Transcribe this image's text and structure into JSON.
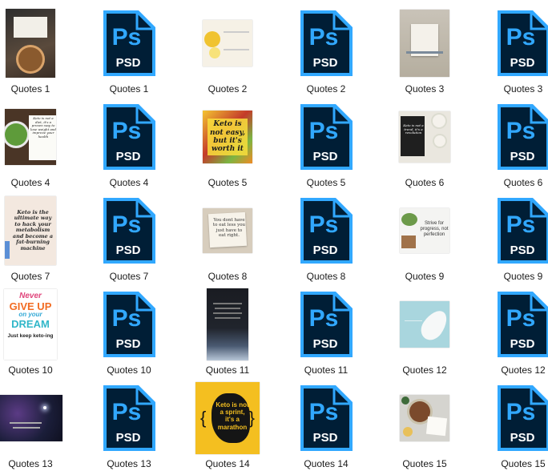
{
  "psd_icon": {
    "big": "Ps",
    "small": "PSD",
    "colors": {
      "body": "#001e36",
      "accent": "#31a8ff"
    }
  },
  "items": [
    {
      "label": "Quotes 1",
      "type": "image"
    },
    {
      "label": "Quotes 1",
      "type": "psd"
    },
    {
      "label": "Quotes 2",
      "type": "image"
    },
    {
      "label": "Quotes 2",
      "type": "psd"
    },
    {
      "label": "Quotes 3",
      "type": "image"
    },
    {
      "label": "Quotes 3",
      "type": "psd"
    },
    {
      "label": "Quotes 4",
      "type": "image"
    },
    {
      "label": "Quotes 4",
      "type": "psd"
    },
    {
      "label": "Quotes 5",
      "type": "image"
    },
    {
      "label": "Quotes 5",
      "type": "psd"
    },
    {
      "label": "Quotes 6",
      "type": "image"
    },
    {
      "label": "Quotes 6",
      "type": "psd"
    },
    {
      "label": "Quotes 7",
      "type": "image"
    },
    {
      "label": "Quotes 7",
      "type": "psd"
    },
    {
      "label": "Quotes 8",
      "type": "image"
    },
    {
      "label": "Quotes 8",
      "type": "psd"
    },
    {
      "label": "Quotes 9",
      "type": "image"
    },
    {
      "label": "Quotes 9",
      "type": "psd"
    },
    {
      "label": "Quotes 10",
      "type": "image"
    },
    {
      "label": "Quotes 10",
      "type": "psd"
    },
    {
      "label": "Quotes 11",
      "type": "image"
    },
    {
      "label": "Quotes 11",
      "type": "psd"
    },
    {
      "label": "Quotes 12",
      "type": "image"
    },
    {
      "label": "Quotes 12",
      "type": "psd"
    },
    {
      "label": "Quotes 13",
      "type": "image"
    },
    {
      "label": "Quotes 13",
      "type": "psd"
    },
    {
      "label": "Quotes 14",
      "type": "image"
    },
    {
      "label": "Quotes 14",
      "type": "psd"
    },
    {
      "label": "Quotes 15",
      "type": "image"
    },
    {
      "label": "Quotes 15",
      "type": "psd"
    }
  ],
  "thumbs": {
    "q4": "Keto is not a diet, it's a proven way to lose weight and improve your health",
    "q5": "Keto is not easy, but it's worth it",
    "q6": "Keto is not a trend, it's a revolution",
    "q7": "Keto is the ultimate way to hack your metabolism and become a fat-burning machine",
    "q8": "You dont have to eat less you just have to eat right.",
    "q9": "Strive for progress, not perfection",
    "q10_a": "Never",
    "q10_b": "GIVE UP",
    "q10_c": "on your",
    "q10_d": "DREAM",
    "q10_e": "Just keep keto-ing",
    "q14": "Keto is not a sprint, it's a marathon"
  }
}
